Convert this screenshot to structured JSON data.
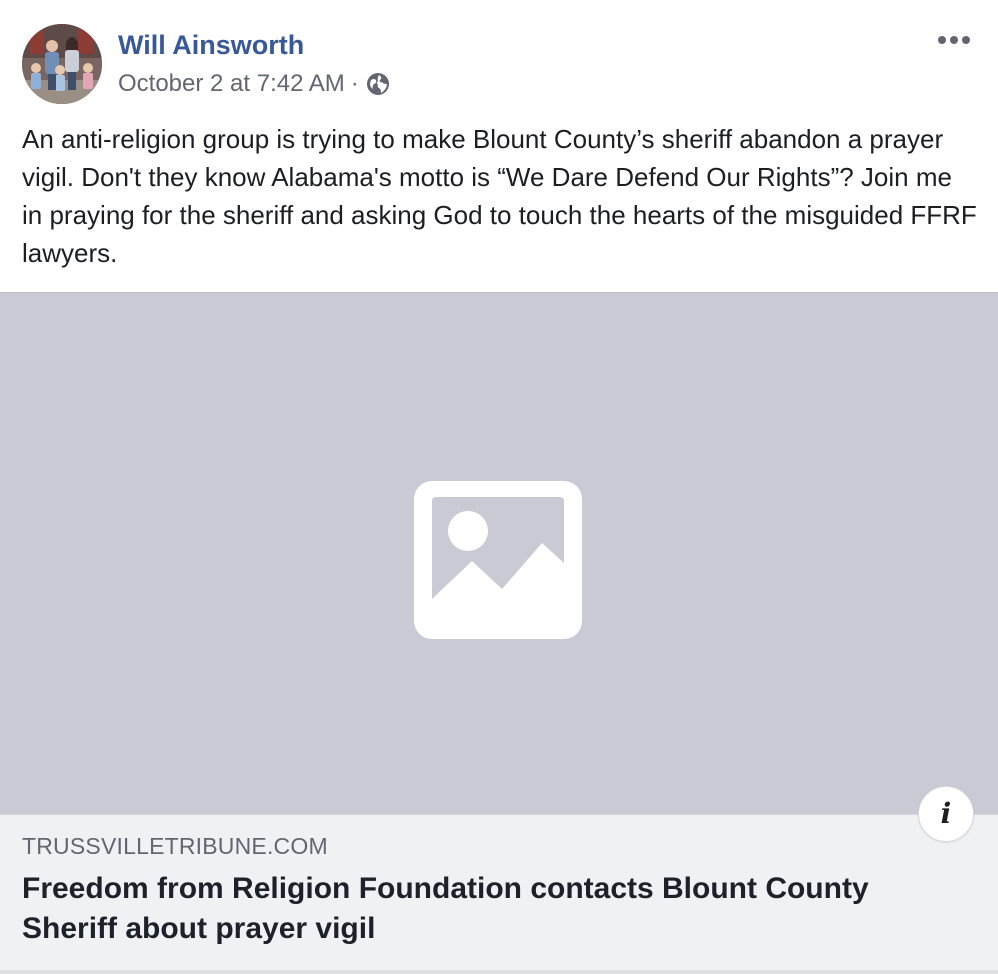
{
  "post": {
    "author": "Will Ainsworth",
    "timestamp": "October 2 at 7:42 AM",
    "separator": "·",
    "privacy_icon": "globe-icon",
    "more_icon": "more-options-icon",
    "message": "An anti-religion group is trying to make Blount County’s sheriff abandon a prayer vigil. Don't they know Alabama's motto is “We Dare Defend Our Rights”? Join me in praying for the sheriff and asking God to touch the hearts of the misguided FFRF lawyers."
  },
  "link_preview": {
    "image_icon": "image-placeholder-icon",
    "domain": "TRUSSVILLETRIBUNE.COM",
    "headline": "Freedom from Religion Foundation contacts Blount County Sheriff about prayer vigil",
    "info_icon": "info-icon",
    "info_glyph": "i"
  },
  "colors": {
    "author_link": "#385898",
    "meta_text": "#606770",
    "body_text": "#1c1e21",
    "media_background": "#c8cbd3",
    "link_box_background": "#f0f1f4"
  }
}
